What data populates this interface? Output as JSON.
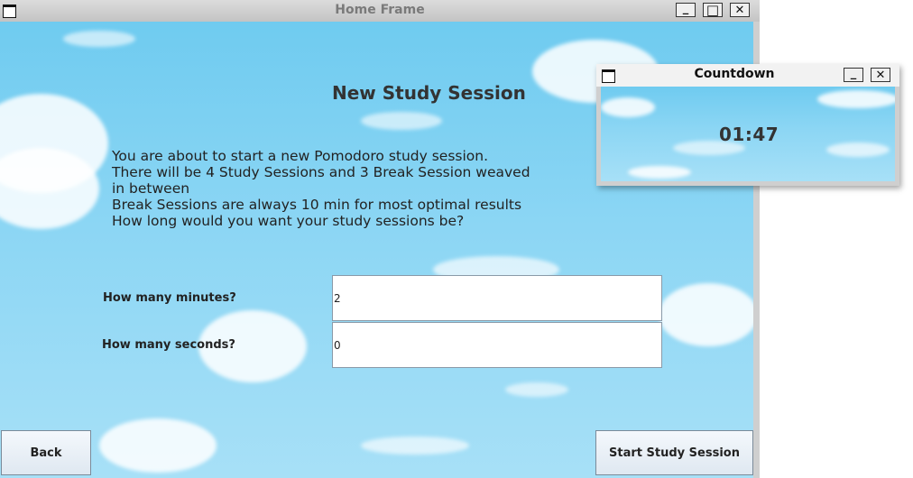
{
  "home_frame": {
    "title": "Home Frame",
    "window_controls": {
      "minimize": "_",
      "maximize": "□",
      "close": "✕"
    },
    "heading": "New Study Session",
    "intro_lines": [
      "You are about to start a new Pomodoro study session.",
      "There will be 4 Study Sessions and 3 Break Session weaved",
      "in between",
      "Break Sessions are always 10 min for most optimal results",
      "How long would you want your study sessions be?"
    ],
    "minutes_label": "How many minutes?",
    "minutes_value": "2",
    "seconds_label": "How many seconds?",
    "seconds_value": "0",
    "back_label": "Back",
    "start_label": "Start Study Session"
  },
  "countdown": {
    "title": "Countdown",
    "window_controls": {
      "minimize": "_",
      "close": "✕"
    },
    "time": "01:47"
  },
  "colors": {
    "sky": "#87d3f3",
    "titlebar": "#d0d0d0"
  }
}
